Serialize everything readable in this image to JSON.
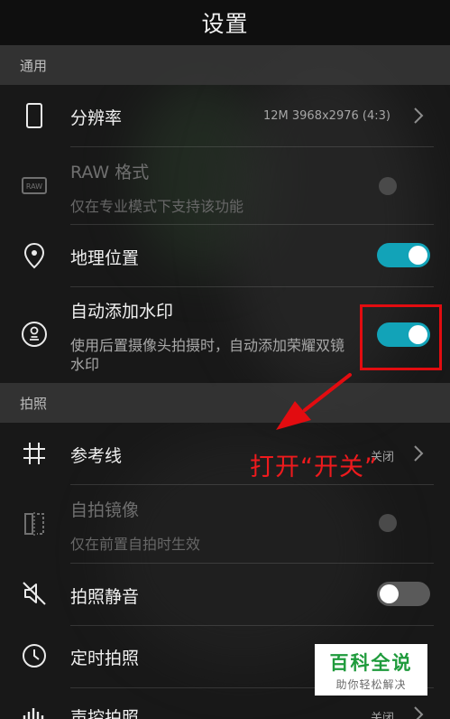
{
  "header": {
    "title": "设置"
  },
  "sections": {
    "general": "通用",
    "photo": "拍照"
  },
  "rows": {
    "resolution": {
      "label": "分辨率",
      "value": "12M 3968x2976 (4:3)",
      "icon": "phone-outline-icon"
    },
    "raw": {
      "label": "RAW 格式",
      "desc": "仅在专业模式下支持该功能",
      "icon": "raw-icon",
      "enabled": false
    },
    "location": {
      "label": "地理位置",
      "toggle": "on",
      "icon": "location-pin-icon"
    },
    "watermark": {
      "label": "自动添加水印",
      "desc": "使用后置摄像头拍摄时，自动添加荣耀双镜水印",
      "toggle": "on",
      "icon": "stamp-icon"
    },
    "grid": {
      "label": "参考线",
      "value": "关闭",
      "icon": "grid-hash-icon"
    },
    "mirror": {
      "label": "自拍镜像",
      "desc": "仅在前置自拍时生效",
      "icon": "mirror-icon",
      "enabled": false
    },
    "mute": {
      "label": "拍照静音",
      "toggle": "off",
      "icon": "mute-speaker-icon"
    },
    "timer": {
      "label": "定时拍照",
      "icon": "clock-icon"
    },
    "voice": {
      "label": "声控拍照",
      "value": "关闭",
      "icon": "sound-wave-icon"
    }
  },
  "annotation": {
    "text": "打开“开关”"
  },
  "watermark_logo": {
    "title": "百科全说",
    "subtitle": "助你轻松解决"
  },
  "colors": {
    "accent": "#12a3b8",
    "annotation_red": "#e20c10",
    "logo_green": "#1f9b3c"
  }
}
